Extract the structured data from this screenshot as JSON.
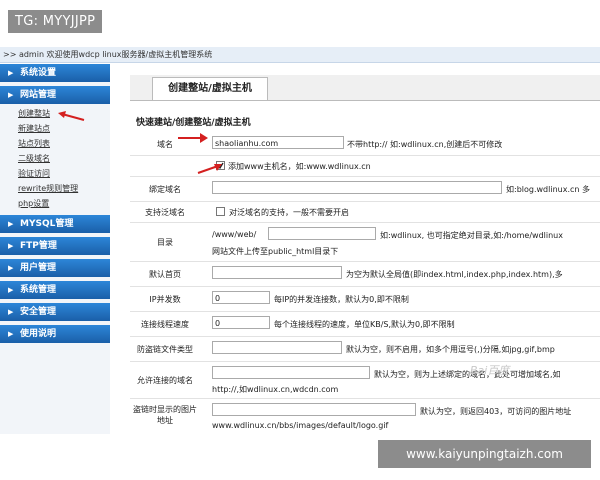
{
  "watermark_tag": "TG: MYYJJPP",
  "watermark_url": "www.kaiyunpingtaizh.com",
  "baidu_mark": "Bai百度",
  "breadcrumb": ">> admin 欢迎使用wdcp linux服务器/虚拟主机管理系统",
  "sidebar": {
    "menus": [
      {
        "label": "系统设置"
      },
      {
        "label": "网站管理",
        "items": [
          "创建整站",
          "新建站点",
          "站点列表",
          "二级域名",
          "验证访问",
          "rewrite规则管理",
          "php设置"
        ]
      },
      {
        "label": "MYSQL管理"
      },
      {
        "label": "FTP管理"
      },
      {
        "label": "用户管理"
      },
      {
        "label": "系统管理"
      },
      {
        "label": "安全管理"
      },
      {
        "label": "使用说明"
      }
    ]
  },
  "main": {
    "tab": "创建整站/虚拟主机",
    "section_title": "快速建站/创建整站/虚拟主机",
    "domain": {
      "label": "域名",
      "value": "shaolianhu.com",
      "hint": "不带http:// 如:wdlinux.cn,创建后不可修改",
      "www_checkbox_label": "添加www主机名，如:www.wdlinux.cn",
      "www_checked": true
    },
    "bind": {
      "label": "绑定域名",
      "value": "",
      "hint": "如:blog.wdlinux.cn 多"
    },
    "wildcard": {
      "label": "支持泛域名",
      "checkbox_label": "对泛域名的支持，一般不需要开启",
      "checked": false
    },
    "dir": {
      "label": "目录",
      "prefix": "/www/web/",
      "value": "",
      "hint": "如:wdlinux, 也可指定绝对目录,如:/home/wdlinux",
      "hint2": "网站文件上传至public_html目录下"
    },
    "index": {
      "label": "默认首页",
      "value": "",
      "hint": "为空为默认全局值(即index.html,index.php,index.htm),多"
    },
    "ip_conn": {
      "label": "IP并发数",
      "value": "0",
      "hint": "每IP的并发连接数，默认为0,即不限制"
    },
    "speed": {
      "label": "连接线程速度",
      "value": "0",
      "hint": "每个连接线程的速度，单位KB/S,默认为0,即不限制"
    },
    "hotlink": {
      "label": "防盗链文件类型",
      "value": "",
      "hint": "默认为空，则不启用，如多个用逗号(,)分隔,如jpg,gif,bmp"
    },
    "allowed": {
      "label": "允许连接的域名",
      "value": "",
      "hint": "默认为空，则为上述绑定的域名，此处可增加域名,如",
      "hint2": "http://,如wdlinux.cn,wdcdn.com"
    },
    "hotlink_img": {
      "label": "盗链时显示的图片地址",
      "value": "",
      "hint": "默认为空，则返回403，可访问的图片地址",
      "hint2": "www.wdlinux.cn/bbs/images/default/logo.gif"
    }
  },
  "colors": {
    "menu_blue": "#1f6dbf",
    "arrow_red": "#d42020"
  }
}
